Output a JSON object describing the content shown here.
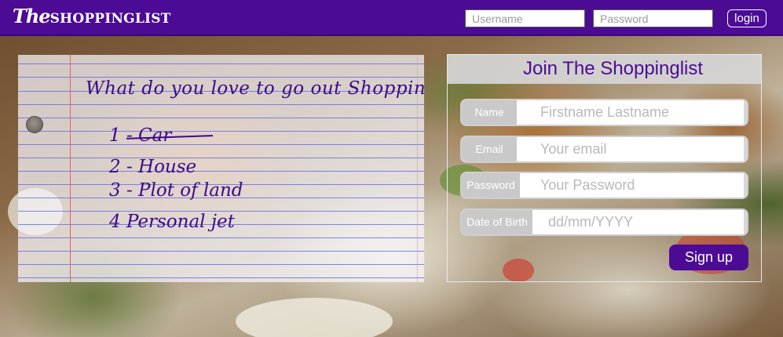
{
  "colors": {
    "brand_purple": "#4b0b95",
    "ink": "#3a0a8a",
    "field_label_bg": "#c9c9c9",
    "placeholder": "#b9b9b9"
  },
  "header": {
    "logo_the": "The",
    "logo_name": "SHOPPINGLIST",
    "username_placeholder": "Username",
    "password_placeholder": "Password",
    "login_label": "login"
  },
  "note": {
    "question": "What do you love to go out Shopping?",
    "items": [
      {
        "text": "1 - Car",
        "struck": true
      },
      {
        "text": "2 - House",
        "struck": false
      },
      {
        "text": "3 - Plot of land",
        "struck": false
      },
      {
        "text": "4 Personal jet",
        "struck": false
      }
    ]
  },
  "signup": {
    "title": "Join The Shoppinglist",
    "fields": [
      {
        "label": "Name",
        "placeholder": "Firstname Lastname"
      },
      {
        "label": "Email",
        "placeholder": "Your email"
      },
      {
        "label": "Password",
        "placeholder": "Your Password"
      },
      {
        "label": "Date of Birth",
        "placeholder": "dd/mm/YYYY"
      }
    ],
    "submit_label": "Sign up"
  }
}
